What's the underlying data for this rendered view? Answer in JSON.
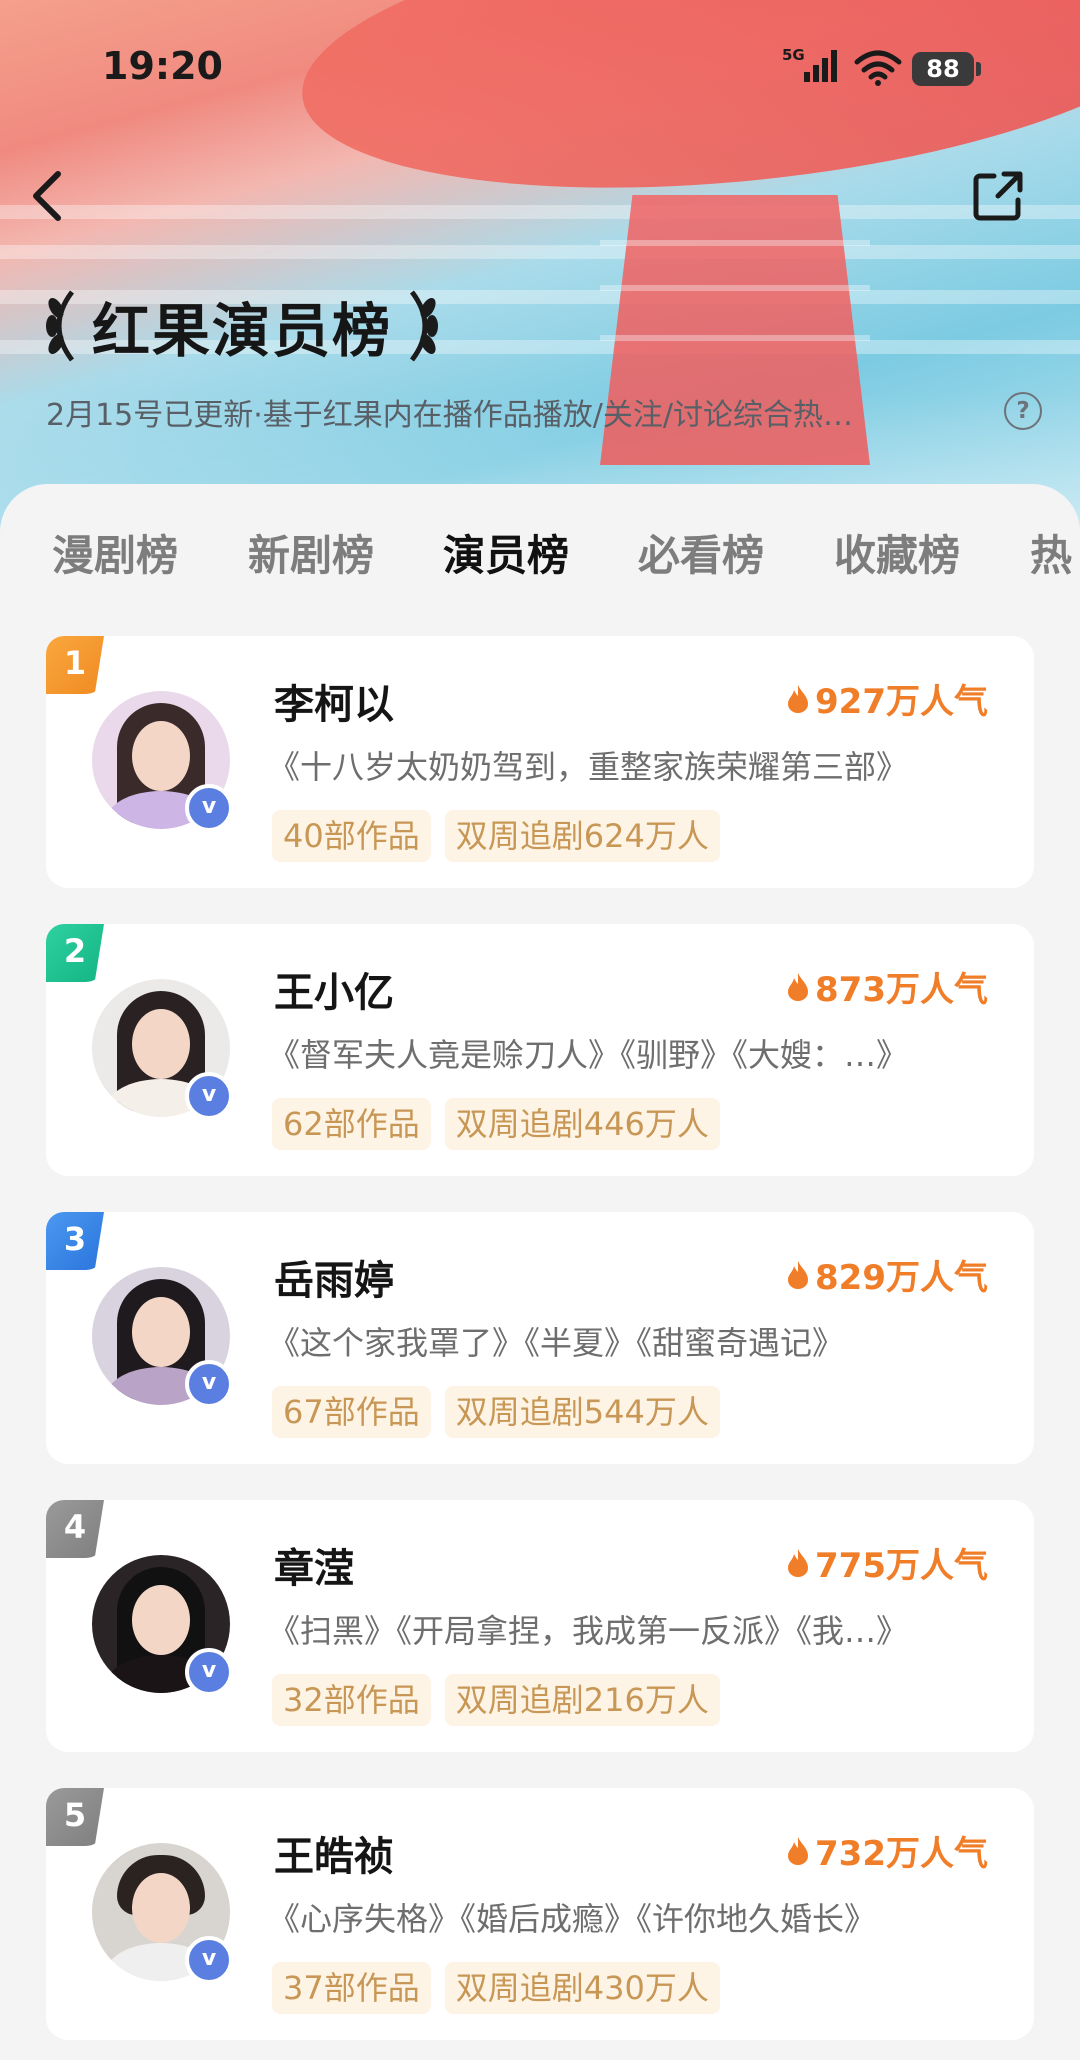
{
  "status_bar": {
    "time": "19:20",
    "network": "5G",
    "battery": "88"
  },
  "header": {
    "title": "红果演员榜",
    "subtitle": "2月15号已更新·基于红果内在播作品播放/关注/讨论综合热…",
    "help_glyph": "?"
  },
  "tabs": [
    {
      "label": "漫剧榜",
      "active": false
    },
    {
      "label": "新剧榜",
      "active": false
    },
    {
      "label": "演员榜",
      "active": true
    },
    {
      "label": "必看榜",
      "active": false
    },
    {
      "label": "收藏榜",
      "active": false
    },
    {
      "label": "热",
      "active": false
    }
  ],
  "colors": {
    "rank_1": "#f4962e",
    "rank_2": "#1fbf8f",
    "rank_3": "#3a86e8",
    "rank_4": "#8f8f8f",
    "rank_5": "#8f8f8f",
    "heat": "#f07d28",
    "tag_text": "#c89755"
  },
  "actors": [
    {
      "rank": "1",
      "name": "李柯以",
      "heat": "927万人气",
      "works": "《十八岁太奶奶驾到，重整家族荣耀第三部》",
      "works_count": "40部作品",
      "followers": "双周追剧624万人",
      "verified": "v"
    },
    {
      "rank": "2",
      "name": "王小亿",
      "heat": "873万人气",
      "works": "《督军夫人竟是赊刀人》《驯野》《大嫂：…》",
      "works_count": "62部作品",
      "followers": "双周追剧446万人",
      "verified": "v"
    },
    {
      "rank": "3",
      "name": "岳雨婷",
      "heat": "829万人气",
      "works": "《这个家我罩了》《半夏》《甜蜜奇遇记》",
      "works_count": "67部作品",
      "followers": "双周追剧544万人",
      "verified": "v"
    },
    {
      "rank": "4",
      "name": "章滢",
      "heat": "775万人气",
      "works": "《扫黑》《开局拿捏，我成第一反派》《我…》",
      "works_count": "32部作品",
      "followers": "双周追剧216万人",
      "verified": "v"
    },
    {
      "rank": "5",
      "name": "王皓祯",
      "heat": "732万人气",
      "works": "《心序失格》《婚后成瘾》《许你地久婚长》",
      "works_count": "37部作品",
      "followers": "双周追剧430万人",
      "verified": "v"
    }
  ]
}
